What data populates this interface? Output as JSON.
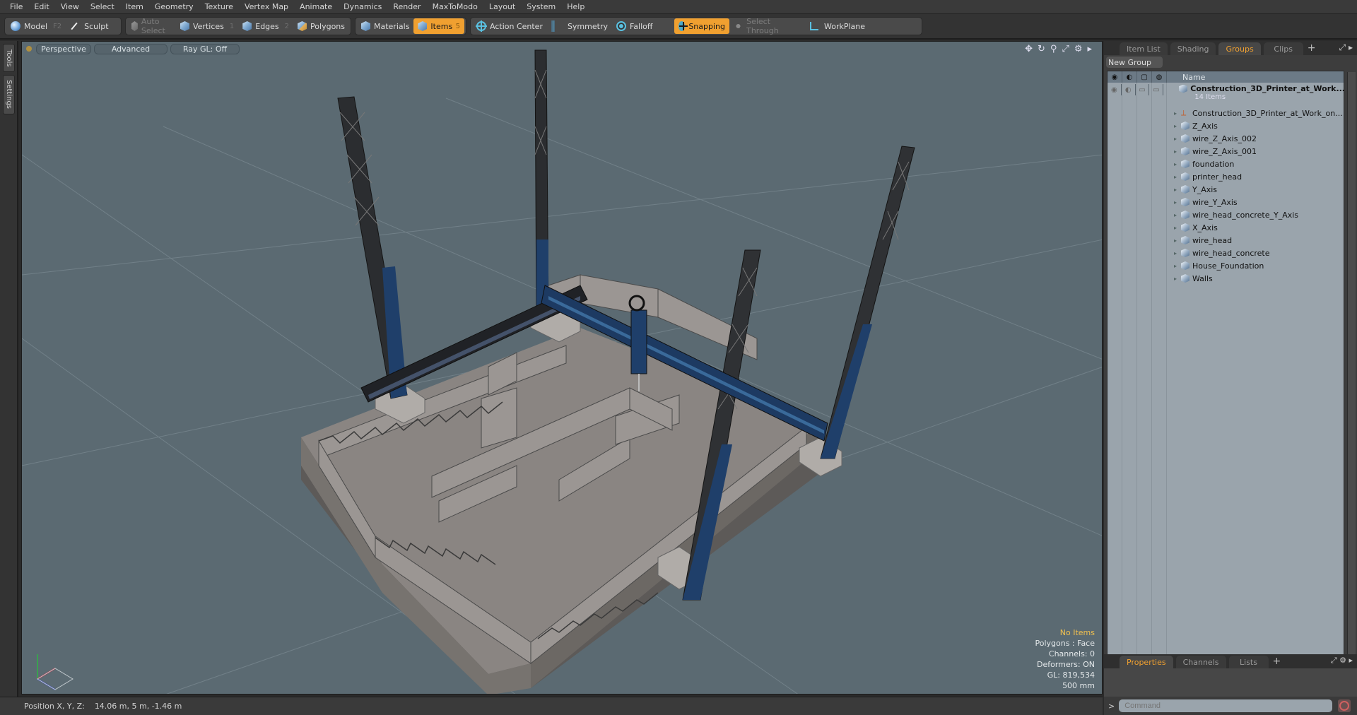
{
  "menu": [
    "File",
    "Edit",
    "View",
    "Select",
    "Item",
    "Geometry",
    "Texture",
    "Vertex Map",
    "Animate",
    "Dynamics",
    "Render",
    "MaxToModo",
    "Layout",
    "System",
    "Help"
  ],
  "toolbar": {
    "model": {
      "label": "Model",
      "key": "F2",
      "icon": "sphere-icon"
    },
    "sculpt": {
      "label": "Sculpt",
      "icon": "brush-icon"
    },
    "auto_select": {
      "label": "Auto Select"
    },
    "vertices": {
      "label": "Vertices",
      "key": "1"
    },
    "edges": {
      "label": "Edges",
      "key": "2"
    },
    "polygons": {
      "label": "Polygons"
    },
    "materials": {
      "label": "Materials"
    },
    "items": {
      "label": "Items",
      "key": "5",
      "active": true
    },
    "action_center": {
      "label": "Action Center"
    },
    "symmetry": {
      "label": "Symmetry"
    },
    "falloff": {
      "label": "Falloff"
    },
    "snapping": {
      "label": "Snapping",
      "active": true
    },
    "select_through": {
      "label": "Select Through"
    },
    "workplane": {
      "label": "WorkPlane"
    },
    "accent_color": "#f0a030"
  },
  "left_tabs": [
    "Tools",
    "Settings"
  ],
  "viewport": {
    "view": "Perspective",
    "shading": "Advanced",
    "raygl": "Ray GL: Off",
    "hud": {
      "selection": "No Items",
      "mode": "Polygons : Face",
      "channels": "Channels: 0",
      "deformers": "Deformers: ON",
      "gl": "GL: 819,534",
      "scale": "500 mm"
    }
  },
  "status": {
    "label": "Position X, Y, Z:",
    "value": "14.06 m, 5 m, -1.46 m"
  },
  "right_panel": {
    "tabs": [
      "Item List",
      "Shading",
      "Groups",
      "Clips"
    ],
    "active_tab": "Groups",
    "new_group": "New Group",
    "name_header": "Name",
    "group": {
      "name": "Construction_3D_Printer_at_Work...",
      "count": "14 Items"
    },
    "items": [
      {
        "name": "Construction_3D_Printer_at_Work_on...",
        "type": "locator"
      },
      {
        "name": "Z_Axis",
        "type": "mesh"
      },
      {
        "name": "wire_Z_Axis_002",
        "type": "mesh"
      },
      {
        "name": "wire_Z_Axis_001",
        "type": "mesh"
      },
      {
        "name": "foundation",
        "type": "mesh"
      },
      {
        "name": "printer_head",
        "type": "mesh"
      },
      {
        "name": "Y_Axis",
        "type": "mesh"
      },
      {
        "name": "wire_Y_Axis",
        "type": "mesh"
      },
      {
        "name": "wire_head_concrete_Y_Axis",
        "type": "mesh"
      },
      {
        "name": "X_Axis",
        "type": "mesh"
      },
      {
        "name": "wire_head",
        "type": "mesh"
      },
      {
        "name": "wire_head_concrete",
        "type": "mesh"
      },
      {
        "name": "House_Foundation",
        "type": "mesh"
      },
      {
        "name": "Walls",
        "type": "mesh"
      }
    ]
  },
  "bottom_panel": {
    "tabs": [
      "Properties",
      "Channels",
      "Lists"
    ],
    "active_tab": "Properties",
    "command_placeholder": "Command",
    "prompt": ">"
  }
}
